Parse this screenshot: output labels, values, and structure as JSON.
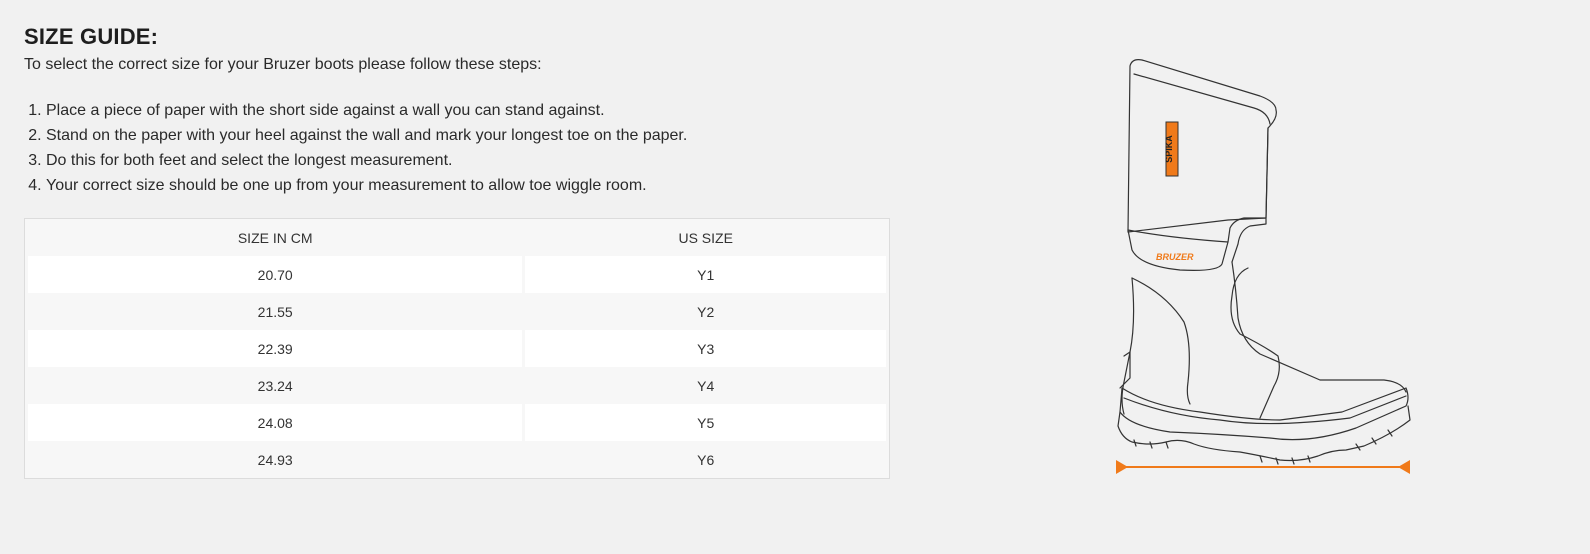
{
  "guide": {
    "title": "SIZE GUIDE:",
    "intro": "To select the correct size for your Bruzer boots please follow these steps:",
    "steps": [
      "Place a piece of paper with the short side against a wall you can stand against.",
      "Stand on the paper with your heel against the wall and mark your longest toe on the paper.",
      "Do this for both feet and select the longest measurement.",
      "Your correct size should be one up from your measurement to allow toe wiggle room."
    ]
  },
  "table": {
    "headers": [
      "SIZE IN CM",
      "US SIZE"
    ],
    "rows": [
      [
        "20.70",
        "Y1"
      ],
      [
        "21.55",
        "Y2"
      ],
      [
        "22.39",
        "Y3"
      ],
      [
        "23.24",
        "Y4"
      ],
      [
        "24.08",
        "Y5"
      ],
      [
        "24.93",
        "Y6"
      ]
    ]
  },
  "illustration": {
    "icon": "boot-outline-icon",
    "brand_label": "BRUZER",
    "tag_label": "SPIKA",
    "accent_color": "#f07a1a"
  }
}
